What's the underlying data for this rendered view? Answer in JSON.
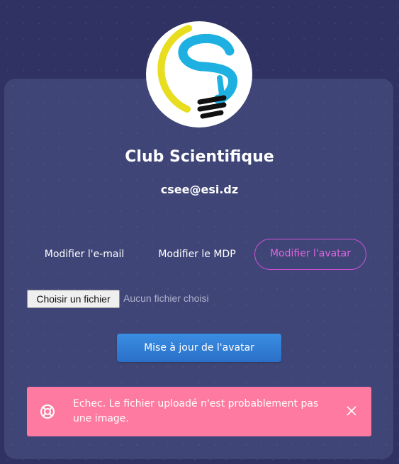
{
  "profile": {
    "name": "Club Scientifique",
    "email": "csee@esi.dz",
    "avatar_icon": "lightbulb-logo"
  },
  "tabs": [
    {
      "label": "Modifier l'e-mail",
      "active": false
    },
    {
      "label": "Modifier le MDP",
      "active": false
    },
    {
      "label": "Modifier l'avatar",
      "active": true
    }
  ],
  "upload": {
    "choose_label": "Choisir un fichier",
    "status": "Aucun fichier choisi"
  },
  "submit_label": "Mise à jour de l'avatar",
  "alert": {
    "message": "Echec. Le fichier uploadé n'est probablement pas une image.",
    "icon": "lifebuoy-icon",
    "close_icon": "close-icon",
    "color": "#ff7aa0"
  },
  "colors": {
    "background": "#2f3262",
    "card": "#3f4677",
    "accent_tab": "#d44fd6",
    "button": "#2f7fd6"
  }
}
